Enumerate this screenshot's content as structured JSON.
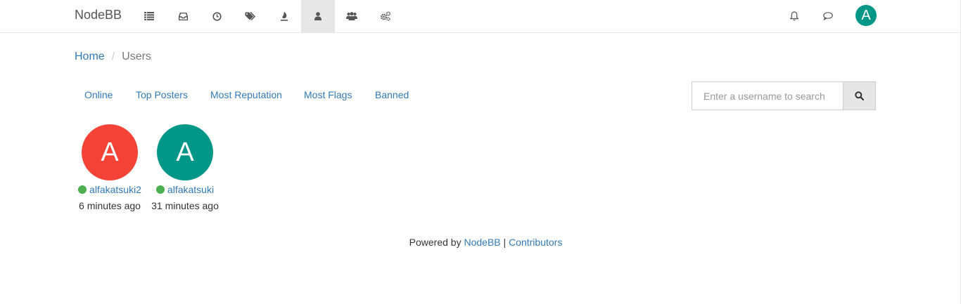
{
  "navbar": {
    "brand": "NodeBB",
    "icons": [
      {
        "name": "categories-icon"
      },
      {
        "name": "unread-icon"
      },
      {
        "name": "recent-icon"
      },
      {
        "name": "tags-icon"
      },
      {
        "name": "popular-icon"
      },
      {
        "name": "users-icon",
        "active": true
      },
      {
        "name": "groups-icon"
      },
      {
        "name": "admin-icon"
      }
    ],
    "user_avatar_letter": "A"
  },
  "breadcrumb": {
    "home": "Home",
    "current": "Users"
  },
  "tabs": [
    "Online",
    "Top Posters",
    "Most Reputation",
    "Most Flags",
    "Banned"
  ],
  "search": {
    "placeholder": "Enter a username to search"
  },
  "users": [
    {
      "letter": "A",
      "username": "alfakatsuki2",
      "time": "6 minutes ago",
      "color": "#f44336",
      "online": true
    },
    {
      "letter": "A",
      "username": "alfakatsuki",
      "time": "31 minutes ago",
      "color": "#009688",
      "online": true
    }
  ],
  "footer": {
    "powered_by": "Powered by",
    "nodebb": "NodeBB",
    "separator": "|",
    "contributors": "Contributors"
  },
  "colors": {
    "link": "#337ab7",
    "online": "#4caf50",
    "active_nav": "#e7e7e7"
  }
}
